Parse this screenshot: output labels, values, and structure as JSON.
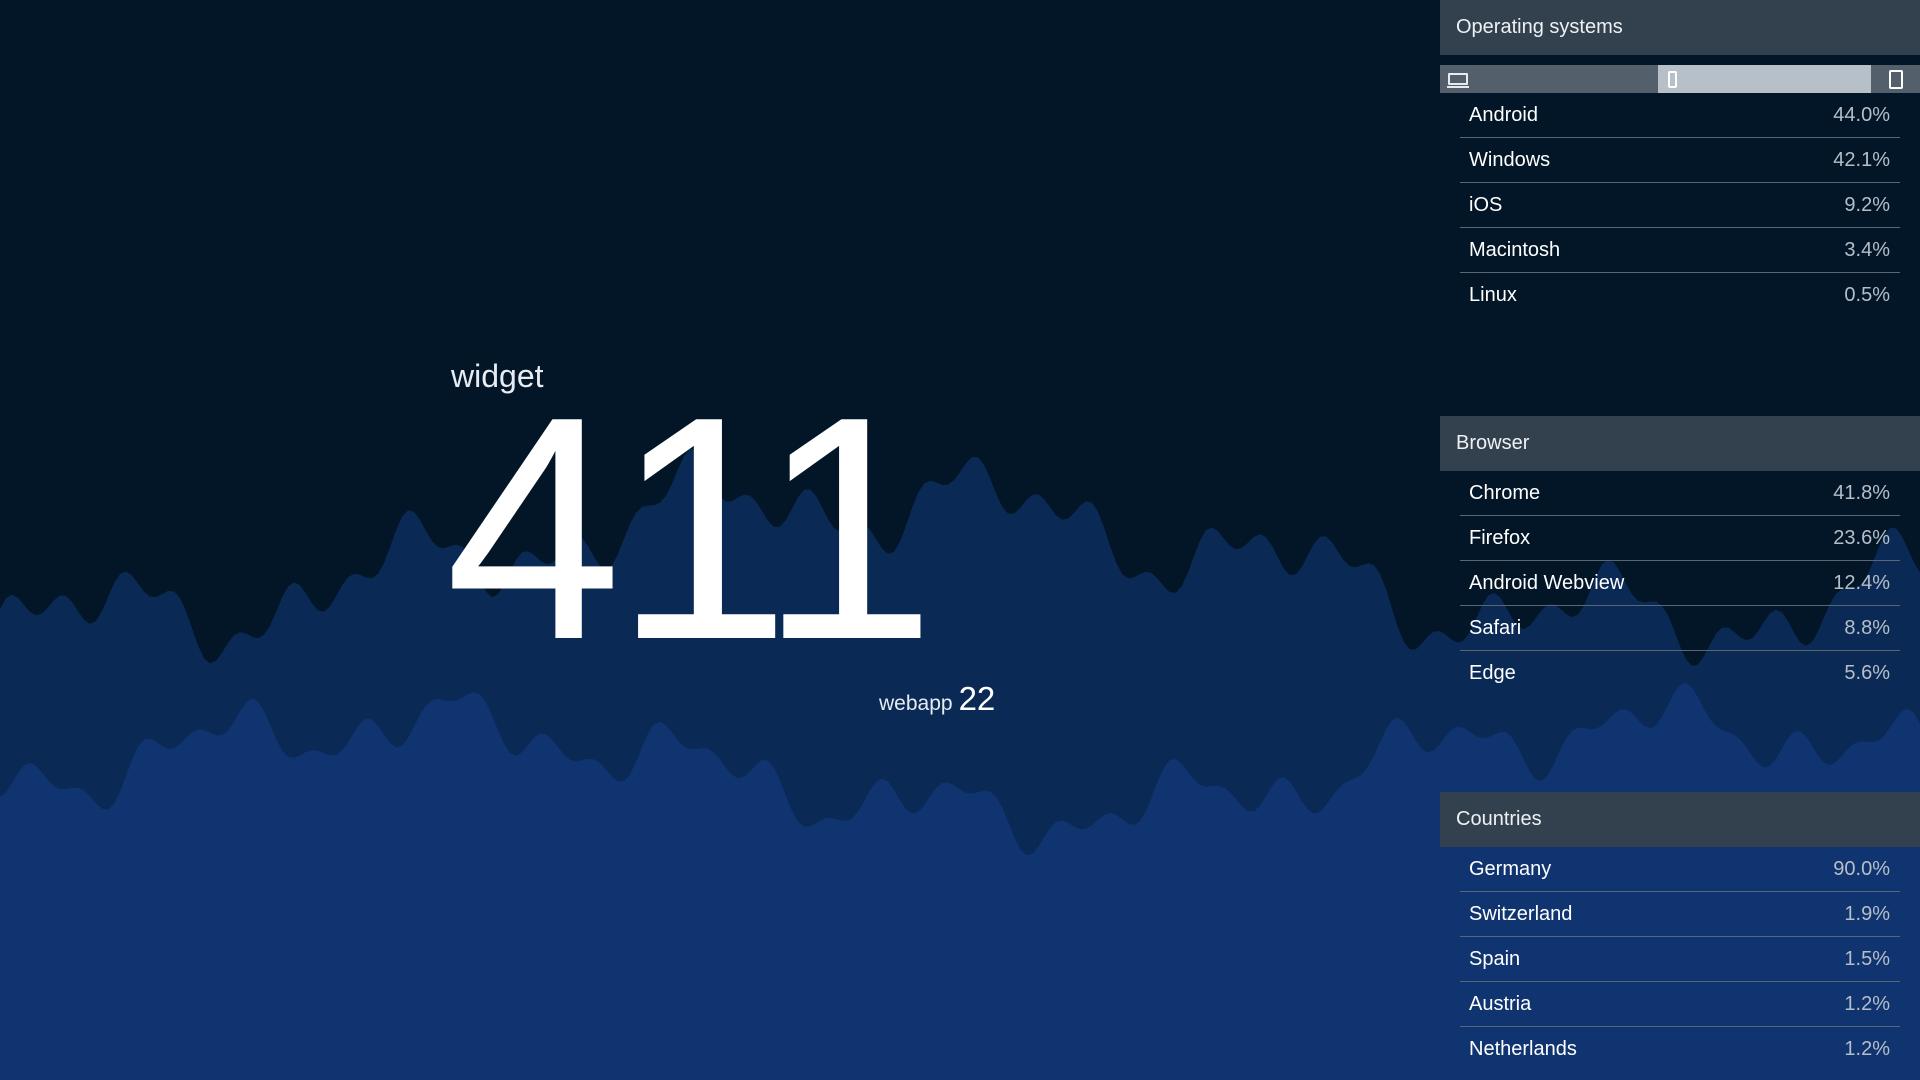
{
  "main_metric": {
    "label": "widget",
    "value": "411"
  },
  "sub_metric": {
    "label": "webapp",
    "value": "22"
  },
  "device_filter": {
    "options": [
      "desktop-icon",
      "smartphone-icon",
      "tablet-icon"
    ],
    "selected": "smartphone-icon"
  },
  "colors": {
    "background": "#021628",
    "area_back": "#0a2a55",
    "area_front": "#0f3470",
    "panel_header": "#33404d"
  },
  "panels": {
    "os": {
      "title": "Operating systems",
      "rows": [
        {
          "name": "Android",
          "pct": "44.0%"
        },
        {
          "name": "Windows",
          "pct": "42.1%"
        },
        {
          "name": "iOS",
          "pct": "9.2%"
        },
        {
          "name": "Macintosh",
          "pct": "3.4%"
        },
        {
          "name": "Linux",
          "pct": "0.5%"
        }
      ]
    },
    "browser": {
      "title": "Browser",
      "rows": [
        {
          "name": "Chrome",
          "pct": "41.8%"
        },
        {
          "name": "Firefox",
          "pct": "23.6%"
        },
        {
          "name": "Android Webview",
          "pct": "12.4%"
        },
        {
          "name": "Safari",
          "pct": "8.8%"
        },
        {
          "name": "Edge",
          "pct": "5.6%"
        }
      ]
    },
    "countries": {
      "title": "Countries",
      "rows": [
        {
          "name": "Germany",
          "pct": "90.0%"
        },
        {
          "name": "Switzerland",
          "pct": "1.9%"
        },
        {
          "name": "Spain",
          "pct": "1.5%"
        },
        {
          "name": "Austria",
          "pct": "1.2%"
        },
        {
          "name": "Netherlands",
          "pct": "1.2%"
        }
      ]
    }
  }
}
